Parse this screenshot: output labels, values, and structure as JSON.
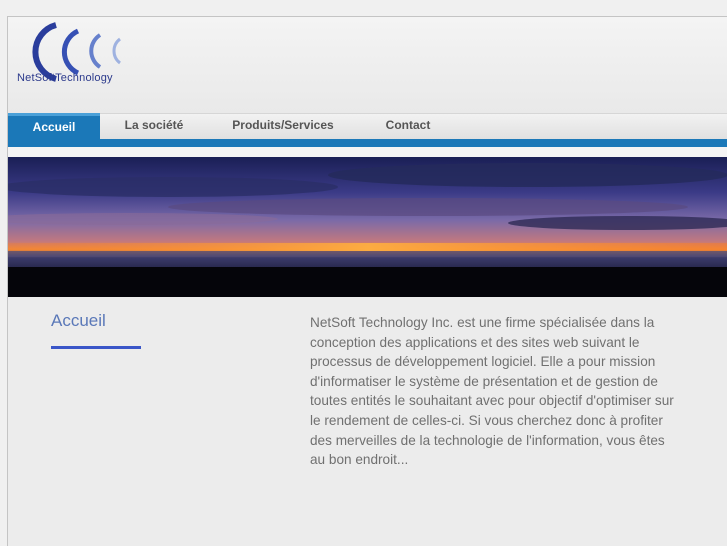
{
  "brand": {
    "name": "NetSoftTechnology"
  },
  "nav": {
    "items": [
      {
        "label": "Accueil",
        "active": true
      },
      {
        "label": "La société",
        "active": false
      },
      {
        "label": "Produits/Services",
        "active": false
      },
      {
        "label": "Contact",
        "active": false
      }
    ]
  },
  "main": {
    "title": "Accueil",
    "intro": "NetSoft Technology Inc. est une firme spécialisée dans la conception des applications et des sites web suivant le processus de développement logiciel. Elle a pour mission d'informatiser le système de présentation et de gestion de toutes entités le souhaitant avec pour objectif d'optimiser sur le rendement de celles-ci. Si vous cherchez donc à profiter des merveilles de la technologie de l'information, vous êtes au bon endroit..."
  },
  "colors": {
    "accent": "#1b78b8",
    "title": "#5a78b8",
    "underline": "#3a56c8"
  }
}
